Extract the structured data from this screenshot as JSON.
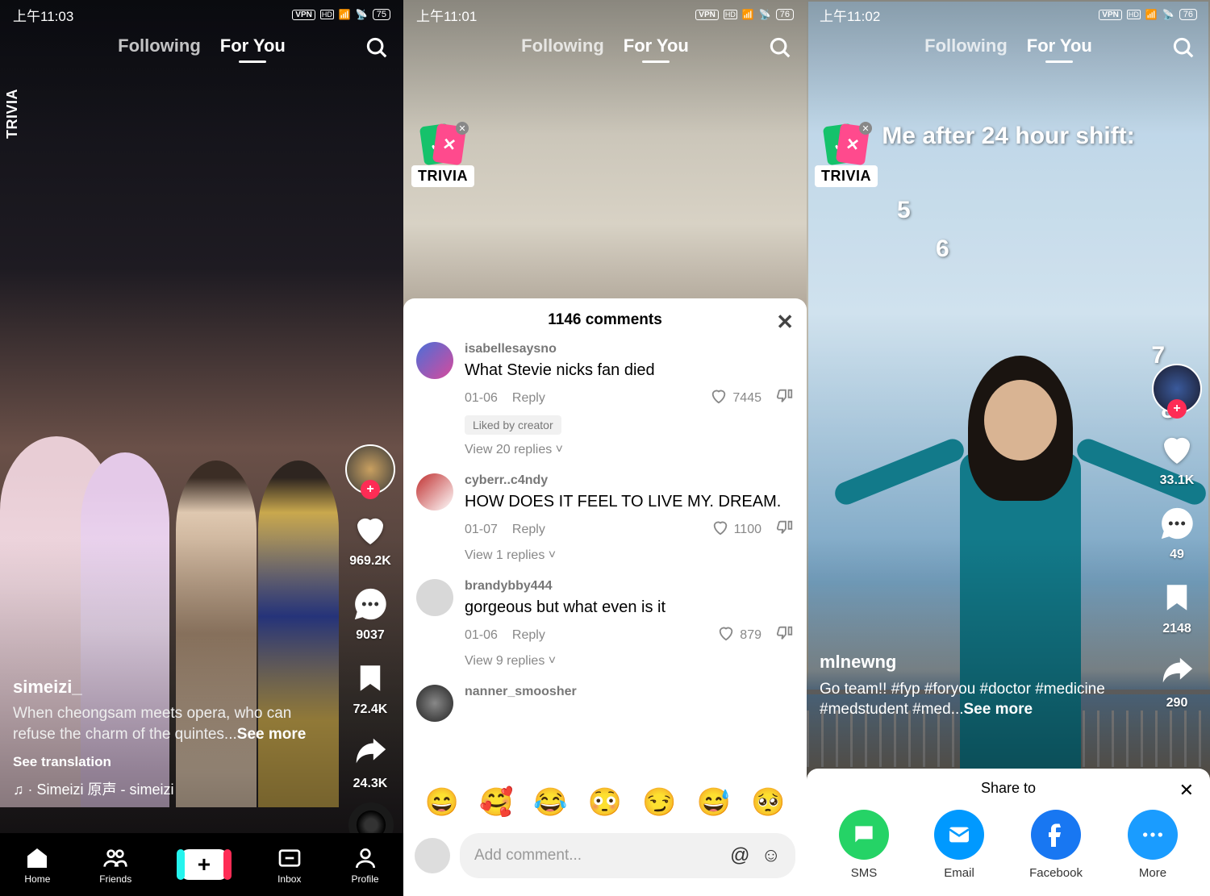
{
  "panes": [
    {
      "status": {
        "time": "上午11:03",
        "vpn": "VPN",
        "hd": "HD",
        "batt": "75"
      },
      "tabs": {
        "following": "Following",
        "foryou": "For You"
      },
      "trivia": "TRIVIA",
      "actions": {
        "likes": "969.2K",
        "comments": "9037",
        "saves": "72.4K",
        "shares": "24.3K"
      },
      "info": {
        "user": "simeizi_",
        "caption": "When cheongsam meets opera, who can refuse the charm of the quintes...",
        "more": "See more",
        "trans": "See translation",
        "music": "♫ · Simeizi   原声 - simeizi"
      },
      "nav": {
        "home": "Home",
        "friends": "Friends",
        "inbox": "Inbox",
        "profile": "Profile"
      }
    },
    {
      "status": {
        "time": "上午11:01",
        "vpn": "VPN",
        "hd": "HD",
        "batt": "76"
      },
      "tabs": {
        "following": "Following",
        "foryou": "For You"
      },
      "trivia": "TRIVIA",
      "commentsTitle": "1146 comments",
      "comments": [
        {
          "user": "isabellesaysno",
          "text": "What Stevie nicks fan died",
          "date": "01-06",
          "reply": "Reply",
          "likes": "7445",
          "liked": "Liked by creator",
          "view": "View 20 replies ˅",
          "av": "linear-gradient(135deg,#4a6fd8,#d84a9c)"
        },
        {
          "user": "cyberr..c4ndy",
          "text": "HOW DOES IT FEEL TO LIVE MY. DREAM.",
          "date": "01-07",
          "reply": "Reply",
          "likes": "1100",
          "view": "View 1 replies ˅",
          "av": "linear-gradient(135deg,#c03030,#fff)"
        },
        {
          "user": "brandybby444",
          "text": "gorgeous but what even is it",
          "date": "01-06",
          "reply": "Reply",
          "likes": "879",
          "view": "View 9 replies ˅",
          "av": "#d8d8d8"
        },
        {
          "user": "nanner_smoosher",
          "text": "",
          "date": "",
          "reply": "",
          "likes": "",
          "view": "",
          "av": "radial-gradient(circle,#888,#222)"
        }
      ],
      "addComment": "Add comment...",
      "emojis": [
        "😄",
        "🥰",
        "😂",
        "😳",
        "😏",
        "😅",
        "🥺"
      ]
    },
    {
      "status": {
        "time": "上午11:02",
        "vpn": "VPN",
        "hd": "HD",
        "batt": "76"
      },
      "tabs": {
        "following": "Following",
        "foryou": "For You"
      },
      "trivia": "TRIVIA",
      "overlay": {
        "title": "Me after 24 hour shift:",
        "nums": [
          "5",
          "6",
          "7",
          "8"
        ]
      },
      "actions": {
        "likes": "33.1K",
        "comments": "49",
        "saves": "2148",
        "shares": "290"
      },
      "info": {
        "user": "mlnewng",
        "caption": "Go team!! #fyp #foryou #doctor #medicine #medstudent #med...",
        "more": "See more"
      },
      "share": {
        "title": "Share to",
        "opts": [
          {
            "label": "SMS",
            "color": "#25d366"
          },
          {
            "label": "Email",
            "color": "#0099ff"
          },
          {
            "label": "Facebook",
            "color": "#1877f2"
          },
          {
            "label": "More",
            "color": "#1a9cff"
          }
        ]
      }
    }
  ]
}
